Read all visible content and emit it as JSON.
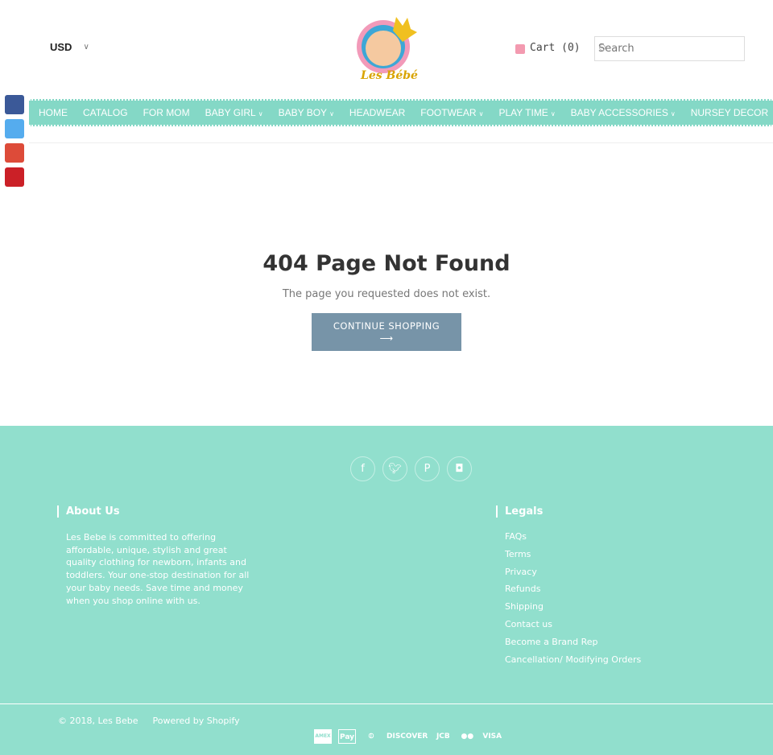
{
  "header": {
    "currency": "USD",
    "cart_label": "Cart (0)",
    "search_placeholder": "Search",
    "logo_text": "Les Bébé"
  },
  "nav": {
    "items": [
      {
        "label": "HOME",
        "dropdown": false
      },
      {
        "label": "CATALOG",
        "dropdown": false
      },
      {
        "label": "FOR MOM",
        "dropdown": false
      },
      {
        "label": "BABY GIRL",
        "dropdown": true
      },
      {
        "label": "BABY BOY",
        "dropdown": true
      },
      {
        "label": "HEADWEAR",
        "dropdown": false
      },
      {
        "label": "FOOTWEAR",
        "dropdown": true
      },
      {
        "label": "PLAY TIME",
        "dropdown": true
      },
      {
        "label": "BABY ACCESSORIES",
        "dropdown": true
      },
      {
        "label": "NURSEY DECOR",
        "dropdown": false
      }
    ]
  },
  "social_share": [
    {
      "name": "facebook",
      "color": "#3b5998"
    },
    {
      "name": "twitter",
      "color": "#55acee"
    },
    {
      "name": "google-plus",
      "color": "#dd4b39"
    },
    {
      "name": "pinterest",
      "color": "#cb2027"
    }
  ],
  "main": {
    "title": "404 Page Not Found",
    "message": "The page you requested does not exist.",
    "button": "CONTINUE SHOPPING",
    "button_arrow": "⟶"
  },
  "footer": {
    "social": [
      "facebook-icon",
      "twitter-icon",
      "pinterest-icon",
      "instagram-icon"
    ],
    "about_title": "About Us",
    "about_text": "Les Bebe is committed to offering affordable, unique, stylish and great quality clothing for newborn, infants and toddlers. Your one-stop destination for all your baby needs. Save time and money when you shop online with us.",
    "legals_title": "Legals",
    "legals": [
      "FAQs",
      "Terms",
      "Privacy",
      "Refunds",
      "Shipping",
      "Contact us",
      "Become a Brand Rep",
      "Cancellation/ Modifying Orders"
    ],
    "copyright": "© 2018, Les Bebe",
    "powered": "Powered by Shopify",
    "payments": [
      "AMEX",
      "Pay",
      "⦶",
      "DISCOVER",
      "JCB",
      "●●",
      "VISA"
    ]
  },
  "colors": {
    "nav": "#84d8c6",
    "footer": "#91dfcd",
    "button": "#7794a8"
  }
}
